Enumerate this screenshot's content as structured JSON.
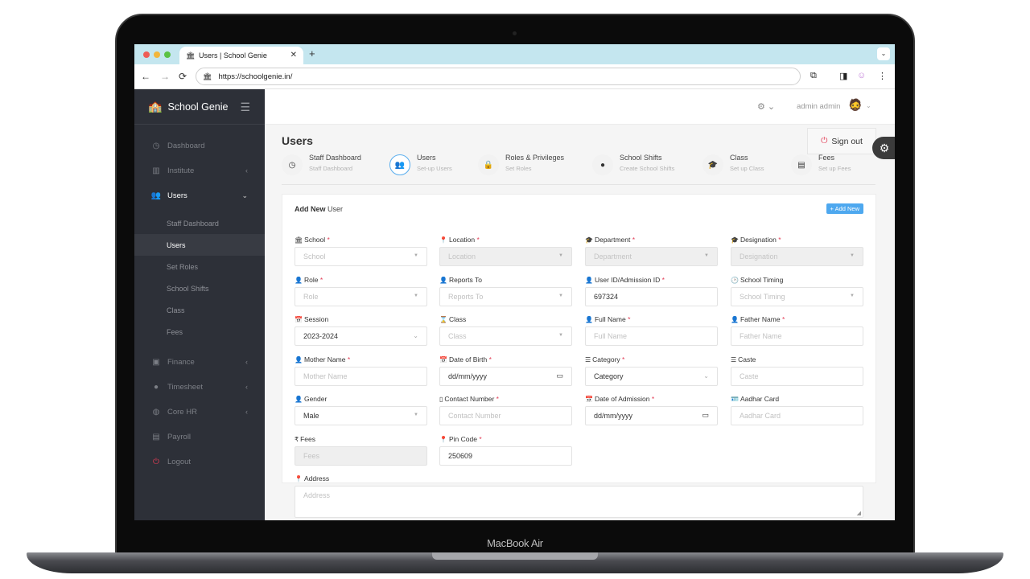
{
  "device": {
    "label": "MacBook Air"
  },
  "browser": {
    "tab_title": "Users | School Genie",
    "url": "https://schoolgenie.in/",
    "new_tab": "+",
    "close": "✕"
  },
  "app": {
    "brand": "School Genie",
    "user_name": "admin admin",
    "signout_label": "Sign out",
    "page_title": "Users"
  },
  "sidebar": {
    "items": [
      {
        "label": "Dashboard",
        "icon": "dashboard-icon"
      },
      {
        "label": "Institute",
        "icon": "building-icon",
        "chevron": "‹"
      },
      {
        "label": "Users",
        "icon": "users-icon",
        "chevron": "⌄"
      },
      {
        "label": "Finance",
        "icon": "money-icon",
        "chevron": "‹"
      },
      {
        "label": "Timesheet",
        "icon": "clock-icon",
        "chevron": "‹"
      },
      {
        "label": "Core HR",
        "icon": "globe-icon",
        "chevron": "‹"
      },
      {
        "label": "Payroll",
        "icon": "calculator-icon"
      },
      {
        "label": "Logout",
        "icon": "power-icon"
      }
    ],
    "sub_items": [
      {
        "label": "Staff Dashboard"
      },
      {
        "label": "Users"
      },
      {
        "label": "Set Roles"
      },
      {
        "label": "School Shifts"
      },
      {
        "label": "Class"
      },
      {
        "label": "Fees"
      }
    ]
  },
  "shortcuts": [
    {
      "title": "Staff Dashboard",
      "subtitle": "Staff Dashboard"
    },
    {
      "title": "Users",
      "subtitle": "Set-up Users"
    },
    {
      "title": "Roles & Privileges",
      "subtitle": "Set Roles"
    },
    {
      "title": "School Shifts",
      "subtitle": "Create School Shifts"
    },
    {
      "title": "Class",
      "subtitle": "Set up Class"
    },
    {
      "title": "Fees",
      "subtitle": "Set up Fees"
    }
  ],
  "form": {
    "title_bold": "Add New",
    "title_rest": "User",
    "add_new_button": "+ Add New",
    "required_mark": "*",
    "fields": {
      "school": {
        "label": "School",
        "placeholder": "School"
      },
      "location": {
        "label": "Location",
        "placeholder": "Location"
      },
      "department": {
        "label": "Department",
        "placeholder": "Department"
      },
      "designation": {
        "label": "Designation",
        "placeholder": "Designation"
      },
      "role": {
        "label": "Role",
        "placeholder": "Role"
      },
      "reports_to": {
        "label": "Reports To",
        "placeholder": "Reports To"
      },
      "user_id": {
        "label": "User ID/Admission ID",
        "value": "697324"
      },
      "school_timing": {
        "label": "School Timing",
        "placeholder": "School Timing"
      },
      "session": {
        "label": "Session",
        "value": "2023-2024"
      },
      "class": {
        "label": "Class",
        "placeholder": "Class"
      },
      "full_name": {
        "label": "Full Name",
        "placeholder": "Full Name"
      },
      "father_name": {
        "label": "Father Name",
        "placeholder": "Father Name"
      },
      "mother_name": {
        "label": "Mother Name",
        "placeholder": "Mother Name"
      },
      "dob": {
        "label": "Date of Birth",
        "value": "dd/mm/yyyy"
      },
      "category": {
        "label": "Category",
        "value": "Category"
      },
      "caste": {
        "label": "Caste",
        "placeholder": "Caste"
      },
      "gender": {
        "label": "Gender",
        "value": "Male"
      },
      "contact": {
        "label": "Contact Number",
        "placeholder": "Contact Number"
      },
      "doa": {
        "label": "Date of Admission",
        "value": "dd/mm/yyyy"
      },
      "aadhar": {
        "label": "Aadhar Card",
        "placeholder": "Aadhar Card"
      },
      "fees": {
        "label": "Fees",
        "placeholder": "Fees"
      },
      "pin_code": {
        "label": "Pin Code",
        "value": "250609"
      },
      "address": {
        "label": "Address",
        "placeholder": "Address"
      }
    }
  }
}
